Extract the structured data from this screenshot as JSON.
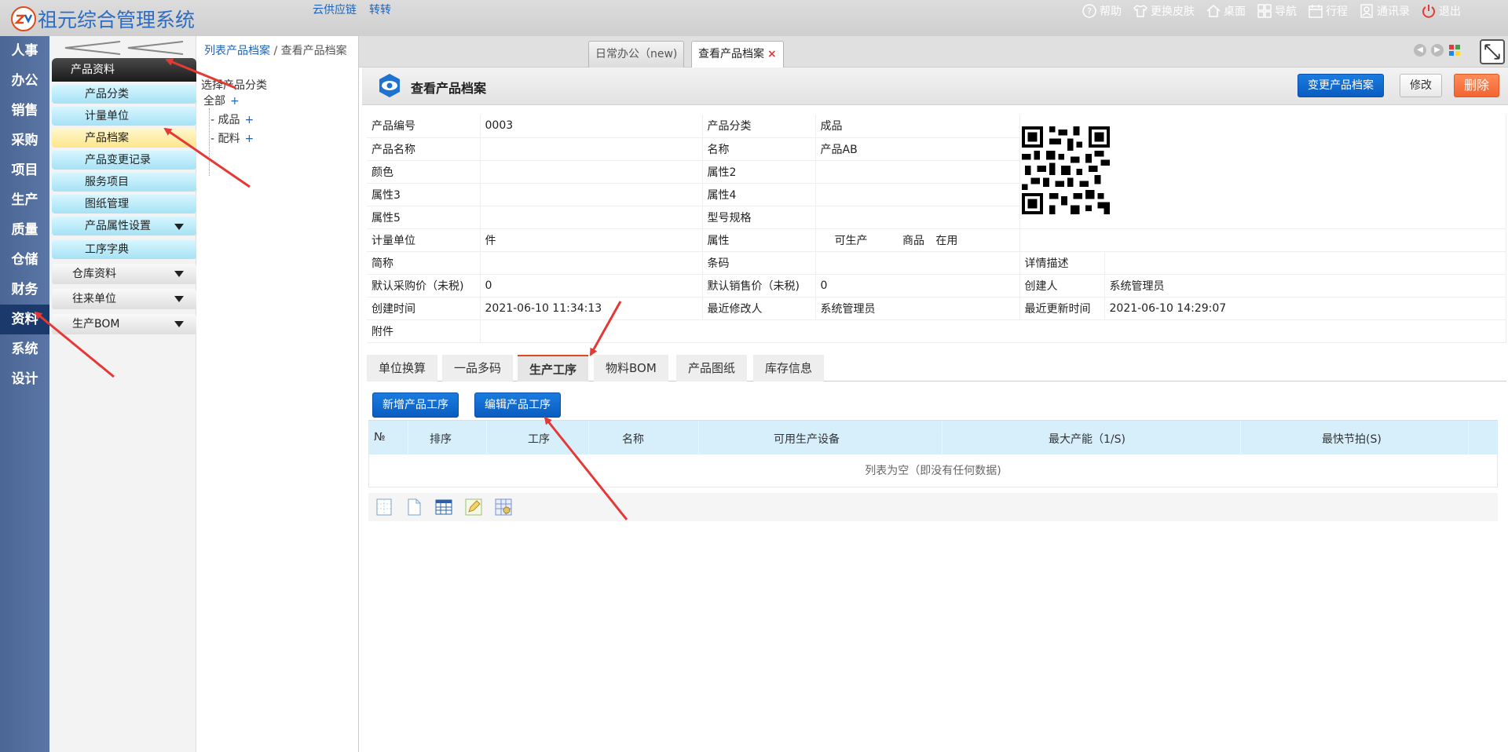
{
  "app": {
    "title": "祖元综合管理系统",
    "top_links": [
      "云供应链",
      "转转"
    ],
    "top_right": [
      "帮助",
      "更换皮肤",
      "桌面",
      "导航",
      "行程",
      "通讯录",
      "退出"
    ]
  },
  "rail": {
    "items": [
      "人事",
      "办公",
      "销售",
      "采购",
      "项目",
      "生产",
      "质量",
      "仓储",
      "财务",
      "资料",
      "系统",
      "设计"
    ],
    "active": "资料"
  },
  "menu": {
    "header": "产品资料",
    "sub_items": [
      "产品分类",
      "计量单位",
      "产品档案",
      "产品变更记录",
      "服务项目",
      "图纸管理",
      "产品属性设置",
      "工序字典"
    ],
    "active_sub": "产品档案",
    "groups": [
      "仓库资料",
      "往来单位",
      "生产BOM"
    ]
  },
  "breadcrumb": {
    "link": "列表产品档案",
    "sep": " / ",
    "current": "查看产品档案"
  },
  "tree": {
    "title": "选择产品分类",
    "root": "全部",
    "children": [
      "成品",
      "配料"
    ],
    "plus": "+"
  },
  "tabs": [
    {
      "label": "日常办公（new)"
    },
    {
      "label": "查看产品档案",
      "close": "×"
    }
  ],
  "page": {
    "title": "查看产品档案",
    "buttons": {
      "change": "变更产品档案",
      "edit": "修改",
      "delete": "删除"
    }
  },
  "info": {
    "rows": [
      [
        "产品编号",
        "0003",
        "产品分类",
        "成品"
      ],
      [
        "产品名称",
        "",
        "名称",
        "产品AB"
      ],
      [
        "颜色",
        "",
        "属性2",
        ""
      ],
      [
        "属性3",
        "",
        "属性4",
        ""
      ],
      [
        "属性5",
        "",
        "型号规格",
        ""
      ]
    ],
    "unit_label": "计量单位",
    "unit_value": "件",
    "attr_label": "属性",
    "attr_values": [
      "可生产",
      "商品",
      "在用"
    ],
    "short_label": "简称",
    "barcode_label": "条码",
    "detail_label": "详情描述",
    "buy_price_label": "默认采购价（未税)",
    "buy_price": "0",
    "sell_price_label": "默认销售价（未税)",
    "sell_price": "0",
    "creator_label": "创建人",
    "creator": "系统管理员",
    "created_label": "创建时间",
    "created": "2021-06-10 11:34:13",
    "modifier_label": "最近修改人",
    "modifier": "系统管理员",
    "updated_label": "最近更新时间",
    "updated": "2021-06-10 14:29:07",
    "attach_label": "附件"
  },
  "subtabs": {
    "items": [
      "单位换算",
      "一品多码",
      "生产工序",
      "物料BOM",
      "产品图纸",
      "库存信息"
    ],
    "active": "生产工序"
  },
  "actions": {
    "add": "新增产品工序",
    "edit": "编辑产品工序"
  },
  "grid": {
    "columns": [
      "№",
      "排序",
      "工序",
      "名称",
      "可用生产设备",
      "最大产能（1/S)",
      "最快节拍(S)"
    ],
    "empty": "列表为空（即没有任何数据)"
  },
  "colors": {
    "rail": "#4b6694",
    "accent_blue": "#0a5cc0",
    "delete": "#f26430",
    "annotation": "#e53935"
  }
}
